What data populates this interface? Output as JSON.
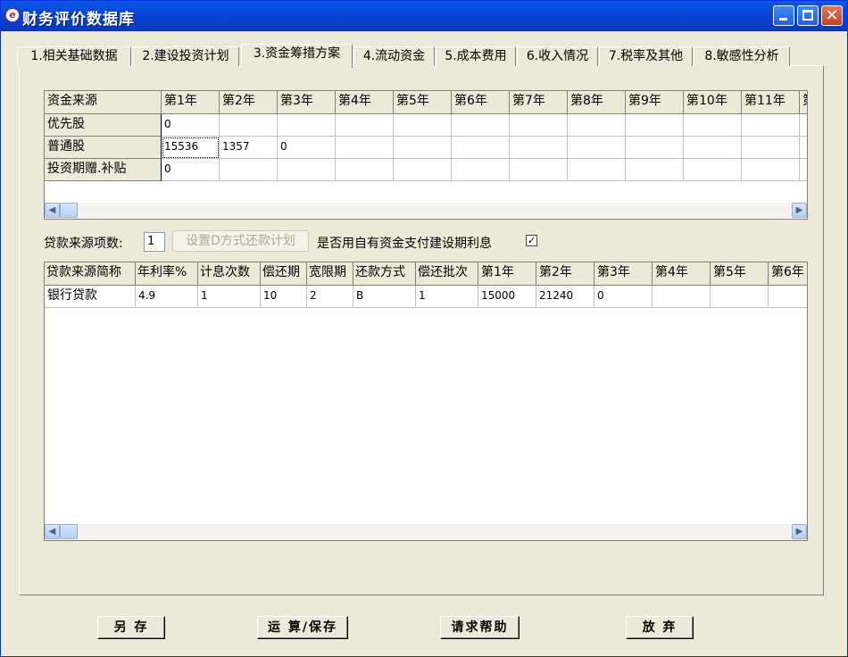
{
  "window": {
    "title": "财务评价数据库"
  },
  "tabs": [
    "1.相关基础数据",
    "2.建设投资计划",
    "3.资金筹措方案",
    "4.流动资金",
    "5.成本费用",
    "6.收入情况",
    "7.税率及其他",
    "8.敏感性分析"
  ],
  "funding_grid": {
    "headers": [
      "资金来源",
      "第1年",
      "第2年",
      "第3年",
      "第4年",
      "第5年",
      "第6年",
      "第7年",
      "第8年",
      "第9年",
      "第10年",
      "第11年",
      "第"
    ],
    "rows": [
      {
        "label": "优先股",
        "values": [
          "0",
          "",
          "",
          "",
          "",
          "",
          "",
          "",
          "",
          "",
          "",
          ""
        ]
      },
      {
        "label": "普通股",
        "values": [
          "15536",
          "1357",
          "0",
          "",
          "",
          "",
          "",
          "",
          "",
          "",
          "",
          ""
        ]
      },
      {
        "label": "投资期赠.补贴",
        "values": [
          "0",
          "",
          "",
          "",
          "",
          "",
          "",
          "",
          "",
          "",
          "",
          ""
        ]
      }
    ]
  },
  "loan_controls": {
    "count_label": "贷款来源项数:",
    "count_value": "1",
    "plan_button": "设置D方式还款计划",
    "interest_label": "是否用自有资金支付建设期利息",
    "interest_checked": "✓"
  },
  "loan_grid": {
    "headers": [
      "贷款来源简称",
      "年利率%",
      "计息次数",
      "偿还期",
      "宽限期",
      "还款方式",
      "偿还批次",
      "第1年",
      "第2年",
      "第3年",
      "第4年",
      "第5年",
      "第6年"
    ],
    "rows": [
      {
        "values": [
          "银行贷款",
          "4.9",
          "1",
          "10",
          "2",
          "B",
          "1",
          "15000",
          "21240",
          "0",
          "",
          "",
          ""
        ]
      }
    ]
  },
  "buttons": {
    "save_as": "另 存",
    "calc_save": "运 算/保存",
    "help": "请求帮助",
    "cancel": "放 弃"
  }
}
